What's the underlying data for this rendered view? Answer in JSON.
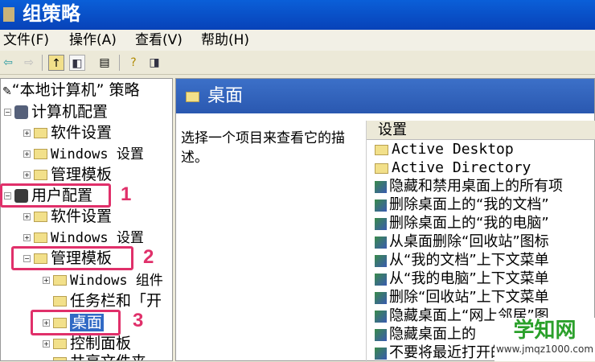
{
  "window": {
    "title": "组策略"
  },
  "menu": [
    "文件(F)",
    "操作(A)",
    "查看(V)",
    "帮助(H)"
  ],
  "tree": {
    "root": "“本地计算机” 策略",
    "computer_config": "计算机配置",
    "cc_children": [
      "软件设置",
      "Windows 设置",
      "管理模板"
    ],
    "user_config": "用户配置",
    "uc_children": [
      "软件设置",
      "Windows 设置",
      "管理模板"
    ],
    "admin_children": [
      "Windows 组件",
      "任务栏和「开",
      "桌面",
      "控制面板",
      "共享文件夹"
    ]
  },
  "annotations": [
    "1",
    "2",
    "3"
  ],
  "right": {
    "title": "桌面",
    "description": "选择一个项目来查看它的描述。",
    "column_header": "设置",
    "folders": [
      "Active Desktop",
      "Active Directory"
    ],
    "settings": [
      "隐藏和禁用桌面上的所有项",
      "删除桌面上的“我的文档”",
      "删除桌面上的“我的电脑”",
      "从桌面删除“回收站”图标",
      "从“我的文档”上下文菜单",
      "从“我的电脑”上下文菜单",
      "删除“回收站”上下文菜单",
      "隐藏桌面上“网上邻居”图",
      "隐藏桌面上的",
      "不要将最近打开的文档的共"
    ]
  },
  "watermark": {
    "title": "学知网",
    "url": "www.jmqz1000.com"
  }
}
